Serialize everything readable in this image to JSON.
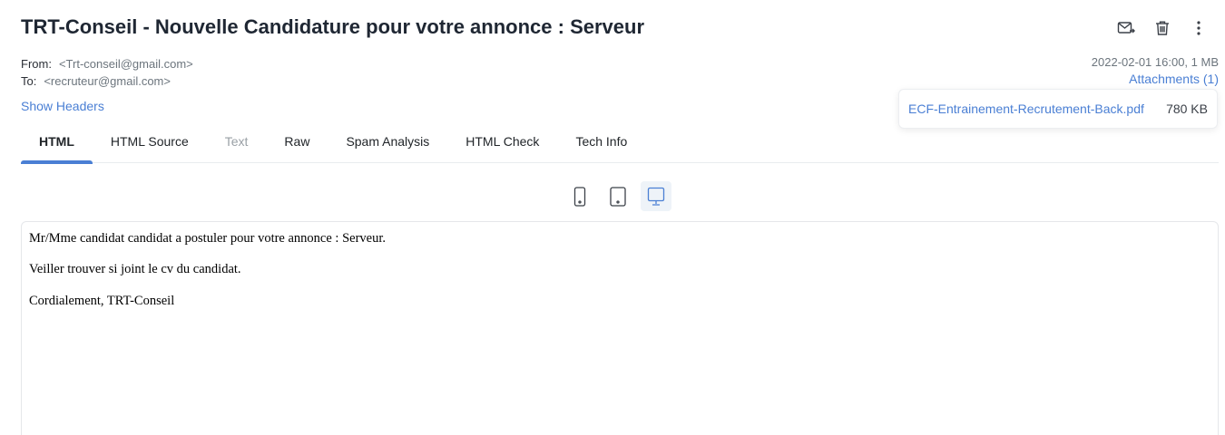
{
  "message": {
    "subject": "TRT-Conseil - Nouvelle Candidature pour votre annonce : Serveur",
    "from_label": "From:",
    "from_value": "<Trt-conseil@gmail.com>",
    "to_label": "To:",
    "to_value": "<recruteur@gmail.com>",
    "date_size": "2022-02-01 16:00, 1 MB",
    "attachments_link": "Attachments (1)",
    "show_headers": "Show Headers"
  },
  "attachments": [
    {
      "name": "ECF-Entrainement-Recrutement-Back.pdf",
      "size": "780 KB"
    }
  ],
  "toolbar": {
    "icons": [
      "mail-forward-icon",
      "trash-icon",
      "more-vertical-icon"
    ]
  },
  "tabs": [
    {
      "label": "HTML",
      "state": "active"
    },
    {
      "label": "HTML Source",
      "state": "normal"
    },
    {
      "label": "Text",
      "state": "disabled"
    },
    {
      "label": "Raw",
      "state": "normal"
    },
    {
      "label": "Spam Analysis",
      "state": "normal"
    },
    {
      "label": "HTML Check",
      "state": "normal"
    },
    {
      "label": "Tech Info",
      "state": "normal"
    }
  ],
  "device_view": {
    "options": [
      "phone",
      "tablet",
      "desktop"
    ],
    "selected": "desktop"
  },
  "body": {
    "lines": [
      "Mr/Mme candidat candidat a postuler pour votre annonce : Serveur.",
      "Veiller trouver si joint le cv du candidat.",
      "Cordialement, TRT-Conseil"
    ]
  },
  "colors": {
    "accent": "#4a7fd4",
    "muted": "#6c757d",
    "active_bg": "#eef3f8"
  }
}
